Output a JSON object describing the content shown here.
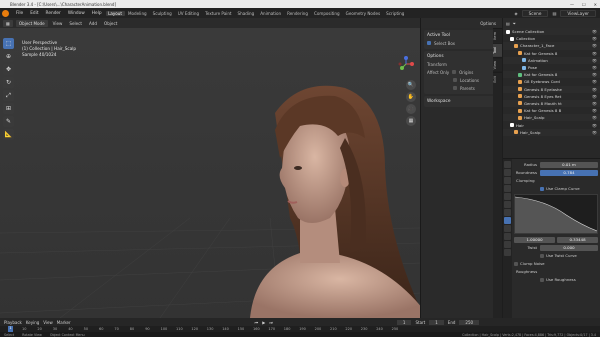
{
  "window": {
    "title": "Blender 3.4 - [C:\\Users\\...\\CharacterAnimation.blend]",
    "controls": [
      "—",
      "☐",
      "✕"
    ]
  },
  "menubar": {
    "items": [
      "File",
      "Edit",
      "Render",
      "Window",
      "Help"
    ],
    "workspaces": [
      "Layout",
      "Modeling",
      "Sculpting",
      "UV Editing",
      "Texture Paint",
      "Shading",
      "Animation",
      "Rendering",
      "Compositing",
      "Geometry Nodes",
      "Scripting"
    ],
    "active_workspace": "Layout",
    "scene": "Scene",
    "view_layer": "ViewLayer"
  },
  "viewport_header": {
    "mode": "Object Mode",
    "menus": [
      "View",
      "Select",
      "Add",
      "Object"
    ],
    "options": "Options"
  },
  "viewport_info": {
    "line1": "User Perspective",
    "line2": "(1) Collection | Hair_Scalp",
    "line3": "Sample 40/1024"
  },
  "toolbar": {
    "tools": [
      "select-box-icon",
      "cursor-icon",
      "move-icon",
      "rotate-icon",
      "scale-icon",
      "transform-icon",
      "annotate-icon",
      "measure-icon"
    ]
  },
  "npanel": {
    "active_tool_title": "Active Tool",
    "select_box": "Select Box",
    "options_title": "Options",
    "transform": "Transform",
    "affect_only": "Affect Only",
    "origins": "Origins",
    "locations": "Locations",
    "parents": "Parents",
    "workspace": "Workspace",
    "tabs": [
      "Item",
      "Tool",
      "View",
      "Edit"
    ]
  },
  "outliner": {
    "header": "Scene Collection",
    "rows": [
      {
        "label": "Scene Collection",
        "color": "#ffffff",
        "indent": 0
      },
      {
        "label": "Collection",
        "color": "#ffffff",
        "indent": 1
      },
      {
        "label": "Character_1_Face",
        "color": "#e8a14f",
        "indent": 2
      },
      {
        "label": "Kat for Genesis 8",
        "color": "#e8a14f",
        "indent": 3
      },
      {
        "label": "Animation",
        "color": "#7fb7e8",
        "indent": 4
      },
      {
        "label": "Pose",
        "color": "#7fb7e8",
        "indent": 4
      },
      {
        "label": "Kat for Genesis 8",
        "color": "#5fbf7f",
        "indent": 3
      },
      {
        "label": "G8 Eyebrows Cord",
        "color": "#e8a14f",
        "indent": 3
      },
      {
        "label": "Genesis 8 Eyelashe",
        "color": "#e8a14f",
        "indent": 3
      },
      {
        "label": "Genesis 8 Eyes Ret",
        "color": "#e8a14f",
        "indent": 3
      },
      {
        "label": "Genesis 8 Mouth ht",
        "color": "#e8a14f",
        "indent": 3
      },
      {
        "label": "Kat for Genesis 8 B",
        "color": "#e8a14f",
        "indent": 3
      },
      {
        "label": "Hair_Scalp",
        "color": "#e8a14f",
        "indent": 3
      },
      {
        "label": "Hair",
        "color": "#ffffff",
        "indent": 1
      },
      {
        "label": "Hair_Scalp",
        "color": "#e8a14f",
        "indent": 2
      }
    ]
  },
  "properties": {
    "radius_label": "Radius",
    "radius_value": "0.01 m",
    "roundness_label": "Roundness",
    "roundness_value": "0.784",
    "clumping": "Clumping",
    "use_clump_curve": "Use Clamp Curve",
    "x_value": "1.00000",
    "y_value": "0.33448",
    "twist_label": "Twist",
    "twist_value": "0.000",
    "use_twist_curve": "Use Twist Curve",
    "clump_noise": "Clump Noise",
    "roughness": "Roughness",
    "use_roughness": "Use Roughness"
  },
  "timeline": {
    "menus": [
      "Playback",
      "Keying",
      "View",
      "Marker"
    ],
    "current_frame": "1",
    "start_label": "Start",
    "start": "1",
    "end_label": "End",
    "end": "250",
    "ticks": [
      "10",
      "20",
      "30",
      "40",
      "50",
      "60",
      "70",
      "80",
      "90",
      "100",
      "110",
      "120",
      "130",
      "140",
      "150",
      "160",
      "170",
      "180",
      "190",
      "200",
      "210",
      "220",
      "230",
      "240",
      "250"
    ]
  },
  "statusbar": {
    "left": [
      "Select",
      "Rotate View",
      "Object Context Menu"
    ],
    "right": "Collection | Hair_Scalp | Verts:2,478 | Faces:4,886 | Tris:9,772 | Objects:0/17 | 3.4"
  }
}
